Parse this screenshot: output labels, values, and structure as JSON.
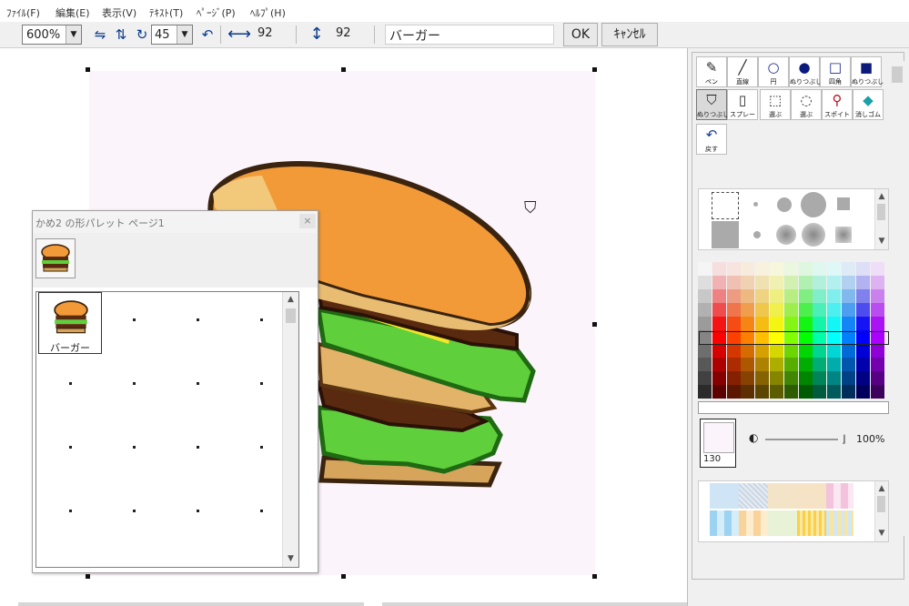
{
  "menu": {
    "file": "ﾌｧｲﾙ(F)",
    "edit": "編集(E)",
    "view": "表示(V)",
    "text": "ﾃｷｽﾄ(T)",
    "page": "ﾍﾟｰｼﾞ(P)",
    "help": "ﾍﾙﾌﾟ(H)"
  },
  "toolbar": {
    "zoom_value": "600%",
    "angle_value": "45",
    "width_value": "92",
    "height_value": "92",
    "name_value": "バーガー",
    "ok_label": "OK",
    "cancel_label": "ｷｬﾝｾﾙ",
    "icons": [
      "flip-horizontal-icon",
      "flip-vertical-icon",
      "rotate-icon",
      "undo-rotate-icon",
      "width-arrow-icon",
      "height-arrow-icon"
    ]
  },
  "palette_window": {
    "title": "かめ2 の形パレット ページ1",
    "close": "×",
    "selected_label": "バーガー"
  },
  "tools": [
    {
      "label": "ペン",
      "icon": "pen-icon"
    },
    {
      "label": "直線",
      "icon": "line-icon"
    },
    {
      "label": "円",
      "icon": "circle-icon"
    },
    {
      "label": "ぬりつぶし",
      "icon": "filled-circle-icon"
    },
    {
      "label": "四角",
      "icon": "square-icon"
    },
    {
      "label": "ぬりつぶし",
      "icon": "filled-square-icon"
    },
    {
      "label": "ぬりつぶし",
      "icon": "bucket-icon"
    },
    {
      "label": "スプレー",
      "icon": "spray-icon"
    },
    {
      "label": "選ぶ",
      "icon": "rect-select-icon"
    },
    {
      "label": "選ぶ",
      "icon": "lasso-select-icon"
    },
    {
      "label": "スポイト",
      "icon": "eyedropper-icon"
    },
    {
      "label": "消しゴム",
      "icon": "eraser-icon"
    },
    {
      "label": "戻す",
      "icon": "undo-icon"
    }
  ],
  "colors": {
    "current_number": "130",
    "opacity": "100%",
    "current_swatch": "#fcf4fb"
  }
}
